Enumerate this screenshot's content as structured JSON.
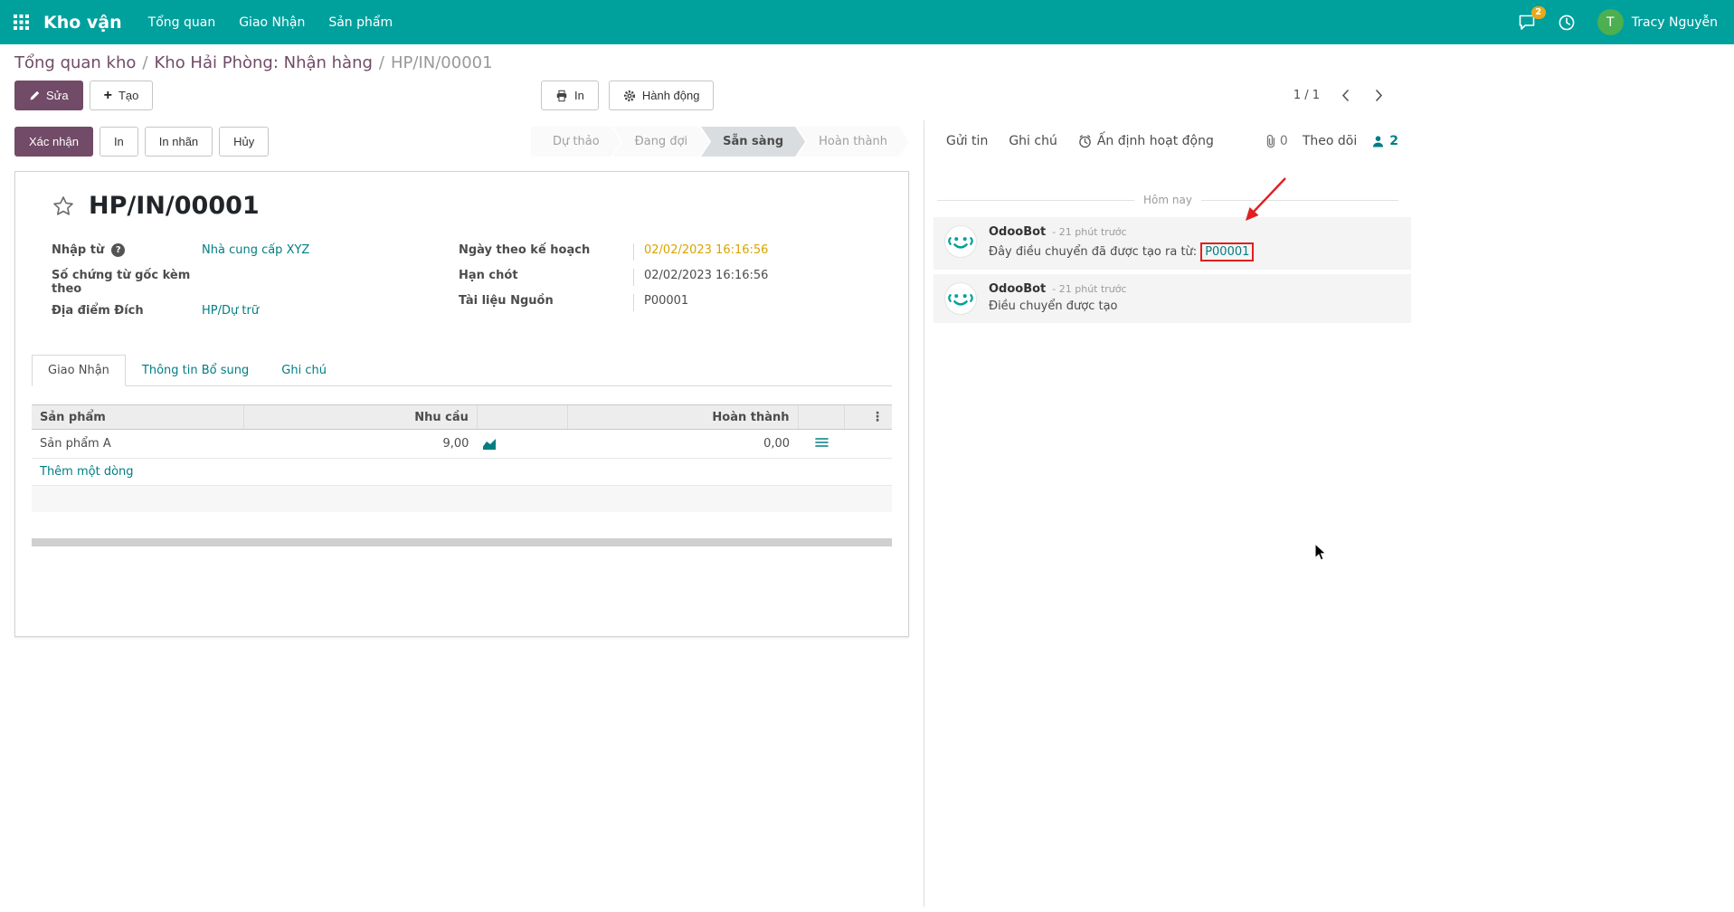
{
  "navbar": {
    "app_name": "Kho vận",
    "menus": [
      {
        "label": "Tổng quan"
      },
      {
        "label": "Giao Nhận"
      },
      {
        "label": "Sản phẩm"
      }
    ],
    "messages_badge": "2",
    "user": {
      "name": "Tracy Nguyễn",
      "initial": "T"
    }
  },
  "breadcrumb": {
    "links": [
      "Tổng quan kho",
      "Kho Hải Phòng: Nhận hàng"
    ],
    "current": "HP/IN/00001",
    "separator": "/"
  },
  "control_panel": {
    "edit": "Sửa",
    "create": "Tạo",
    "print": "In",
    "action": "Hành động",
    "pager": "1 / 1"
  },
  "statusbar": {
    "confirm": "Xác nhận",
    "print": "In",
    "print_labels": "In nhãn",
    "cancel": "Hủy",
    "steps": [
      {
        "label": "Dự thảo",
        "active": false
      },
      {
        "label": "Đang đợi",
        "active": false
      },
      {
        "label": "Sẵn sàng",
        "active": true
      },
      {
        "label": "Hoàn thành",
        "active": false
      }
    ],
    "active_step": "Sẵn sàng"
  },
  "form": {
    "title": "HP/IN/00001",
    "partner": {
      "label": "Nhập từ",
      "value": "Nhà cung cấp XYZ"
    },
    "origin": {
      "label": "Số chứng từ gốc kèm theo",
      "value": ""
    },
    "destination": {
      "label": "Địa điểm Đích",
      "value": "HP/Dự trữ"
    },
    "scheduled_date": {
      "label": "Ngày theo kế hoạch",
      "value": "02/02/2023 16:16:56"
    },
    "deadline": {
      "label": "Hạn chót",
      "value": "02/02/2023 16:16:56"
    },
    "source_document": {
      "label": "Tài liệu Nguồn",
      "value": "P00001"
    },
    "tabs": [
      {
        "label": "Giao Nhận"
      },
      {
        "label": "Thông tin Bổ sung"
      },
      {
        "label": "Ghi chú"
      }
    ],
    "active_tab": "Giao Nhận",
    "lines": {
      "headers": {
        "product": "Sản phẩm",
        "demand": "Nhu cầu",
        "done": "Hoàn thành"
      },
      "rows": [
        {
          "product": "Sản phẩm A",
          "demand": "9,00",
          "done": "0,00"
        }
      ],
      "add_line": "Thêm một dòng"
    }
  },
  "chatter": {
    "send_message": "Gửi tin",
    "log_note": "Ghi chú",
    "schedule_activity": "Ấn định hoạt động",
    "attachments_count": "0",
    "follow": "Theo dõi",
    "followers_count": "2",
    "date_divider": "Hôm nay",
    "messages": [
      {
        "author": "OdooBot",
        "time": "- 21 phút trước",
        "body": "Đây điều chuyển đã được tạo ra từ:",
        "link": "P00001"
      },
      {
        "author": "OdooBot",
        "time": "- 21 phút trước",
        "body": "Điều chuyển được tạo",
        "link": ""
      }
    ]
  },
  "colors": {
    "navbar": "#00a09d",
    "primary_button": "#714b67",
    "link": "#017e84",
    "scheduled_date_warning": "#d9a300",
    "annotation_red": "#e0201f",
    "avatar_green": "#4caf50",
    "badge_amber": "#eaa819"
  }
}
